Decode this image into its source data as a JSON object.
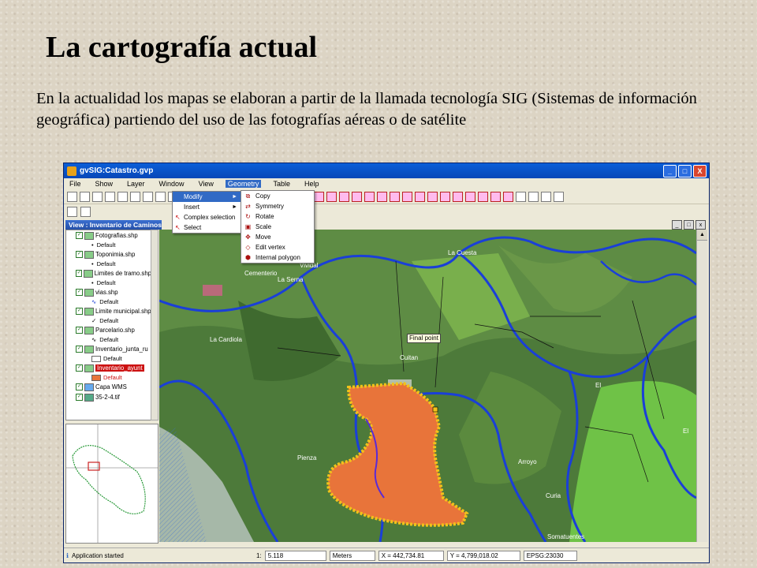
{
  "slide": {
    "title": "La cartografía actual",
    "paragraph": "En la actualidad los mapas se elaboran  a partir de la llamada tecnología SIG (Sistemas de información geográfica) partiendo del uso de las fotografías aéreas o de satélite"
  },
  "window": {
    "title": "gvSIG:Catastro.gvp",
    "buttons": {
      "minimize": "_",
      "maximize": "□",
      "close": "X"
    }
  },
  "menubar": [
    "File",
    "Show",
    "Layer",
    "Window",
    "View",
    "Geometry",
    "Table",
    "Help"
  ],
  "view": {
    "title": "View : Inventario de Caminos"
  },
  "geometry_menu": {
    "items": [
      "Modify",
      "Insert",
      "Complex selection",
      "Select"
    ],
    "submenu": [
      "Copy",
      "Symmetry",
      "Rotate",
      "Scale",
      "Move",
      "Edit vertex",
      "Internal polygon"
    ]
  },
  "layers": [
    {
      "name": "Fotografias.shp",
      "legend": "Default"
    },
    {
      "name": "Toponimia.shp",
      "legend": "Default"
    },
    {
      "name": "Limites de tramo.shp",
      "legend": "Default"
    },
    {
      "name": "vias.shp",
      "legend": "Default"
    },
    {
      "name": "Limite municipal.shp",
      "legend": "Default"
    },
    {
      "name": "Parcelario.shp",
      "legend": "Default"
    },
    {
      "name": "Inventario_junta_ru",
      "legend": "Default"
    },
    {
      "name": "Inventario_ayunt",
      "legend": "Default"
    },
    {
      "name": "Capa WMS",
      "legend": ""
    },
    {
      "name": "35-2-4.tif",
      "legend": ""
    }
  ],
  "map": {
    "final_point_label": "Final point",
    "place_labels": [
      "Cementerio",
      "La Serna",
      "Vividal",
      "La Cuesta",
      "La Cardiola",
      "Cuitan",
      "Pienza",
      "Arroyo",
      "Curia",
      "El",
      "El",
      "Somatuentes"
    ]
  },
  "statusbar": {
    "message": "Application started",
    "scale_prefix": "1:",
    "scale": "5.118",
    "units": "Meters",
    "x": "X = 442,734.81",
    "y": "Y = 4,799,018.02",
    "crs": "EPSG:23030"
  },
  "colors": {
    "accent": "#316ac5",
    "parcel_fill": "#e8743a",
    "selection": "#f2c21a",
    "roads": "#1a3fd8",
    "highlight_layer": "#cc1111"
  }
}
